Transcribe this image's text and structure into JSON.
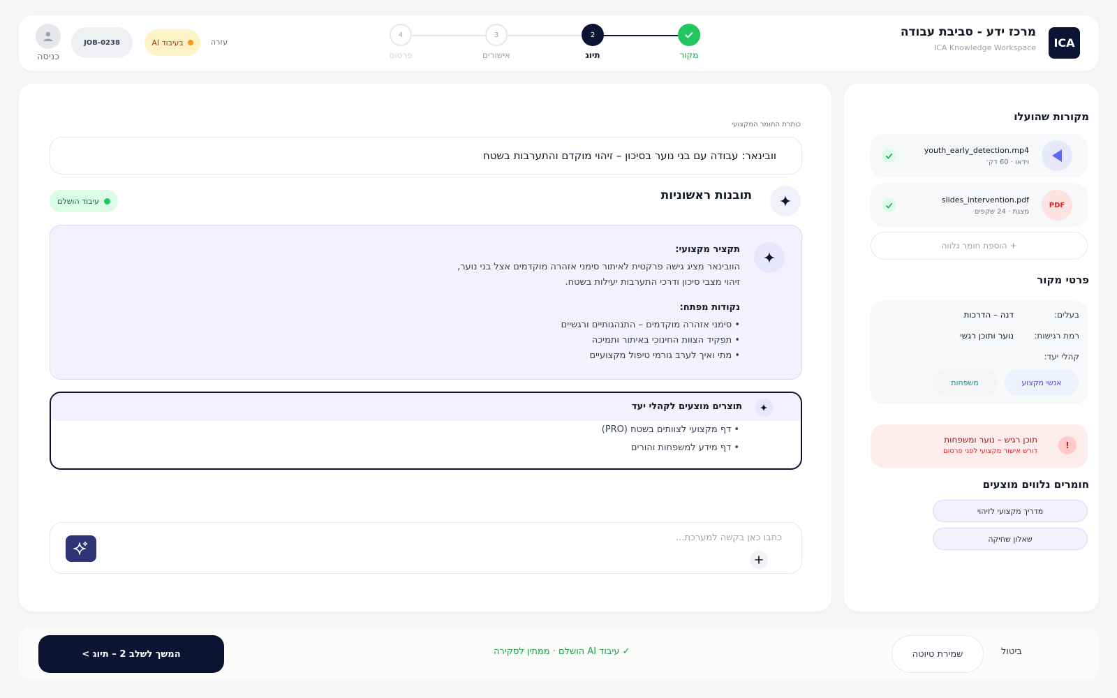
{
  "header": {
    "logo_text": "ICA",
    "app_title": "מרכז ידע - סביבת עבודה",
    "app_subtitle": "ICA Knowledge Workspace",
    "steps": [
      {
        "number": "1",
        "label": "מקור",
        "state": "done"
      },
      {
        "number": "2",
        "label": "תיוג",
        "state": "active"
      },
      {
        "number": "3",
        "label": "אישורים",
        "state": "pending"
      },
      {
        "number": "4",
        "label": "פרסום",
        "state": "pending"
      }
    ],
    "help_label": "עזרה",
    "ai_status_label": "בעיבוד AI",
    "job_id": "JOB-0238",
    "login_label": "כניסה"
  },
  "main": {
    "title_field_label": "כותרת החומר המקצועי",
    "title_value": "וובינאר: עבודה עם בני נוער בסיכון – זיהוי מוקדם והתערבות בשטח",
    "insights_title": "תובנות ראשוניות",
    "processing_status": "עיבוד הושלם",
    "summary": {
      "heading": "תקציר מקצועי:",
      "lines": [
        "הוובינאר מציג גישה פרקטית לאיתור סימני אזהרה מוקדמים אצל בני נוער,",
        "זיהוי מצבי סיכון ודרכי התערבות יעילות בשטח."
      ],
      "key_points_heading": "נקודות מפתח:",
      "key_points": [
        "• סימני אזהרה מוקדמים – התנהגותיים ורגשיים",
        "• תפקיד הצוות החינוכי באיתור ותמיכה",
        "• מתי ואיך לערב גורמי טיפול מקצועיים"
      ]
    },
    "audience": {
      "title": "תוצרים מוצעים לקהלי יעד",
      "items": [
        "• דף מקצועי לצוותים בשטח (PRO)",
        "• דף מידע למשפחות והורים"
      ]
    },
    "prompt_placeholder": "כתבו כאן בקשה למערכת..."
  },
  "sidebar": {
    "sources_title": "מקורות שהועלו",
    "files": [
      {
        "name": "youth_early_detection.mp4",
        "meta": "וידאו · 60 דק׳",
        "icon": "play-icon"
      },
      {
        "name": "slides_intervention.pdf",
        "meta": "מצגת · 24 שקפים",
        "icon_text": "PDF"
      }
    ],
    "add_material_label": "+ הוספת חומר נלווה",
    "details_title": "פרטי מקור",
    "details": {
      "owner_label": "בעלים:",
      "owner_value": "דנה – הדרכות",
      "sensitivity_label": "רמת רגישות:",
      "sensitivity_value": "נוער ותוכן רגשי",
      "audiences_label": "קהלי יעד:",
      "audience_chips": [
        "אנשי מקצוע",
        "משפחות"
      ]
    },
    "alert": {
      "icon_text": "!",
      "title": "תוכן רגיש – נוער ומשפחות",
      "subtitle": "דורש אישור מקצועי לפני פרסום"
    },
    "suggested_title": "חומרים נלווים מוצעים",
    "suggested_materials": [
      "מדריך מקצועי לזיהוי",
      "שאלון שחיקה"
    ]
  },
  "footer": {
    "next_label": "המשך לשלב 2 – תיוג >",
    "status_text": "✓ עיבוד AI הושלם · ממתין לסקירה",
    "save_draft_label": "שמירת טיוטה",
    "cancel_label": "ביטול"
  },
  "colors": {
    "primary": "#0b1533",
    "success": "#22c55e",
    "accent_purple": "#6366f1",
    "warning_bg": "#fdf3c7",
    "danger": "#dc2626"
  }
}
